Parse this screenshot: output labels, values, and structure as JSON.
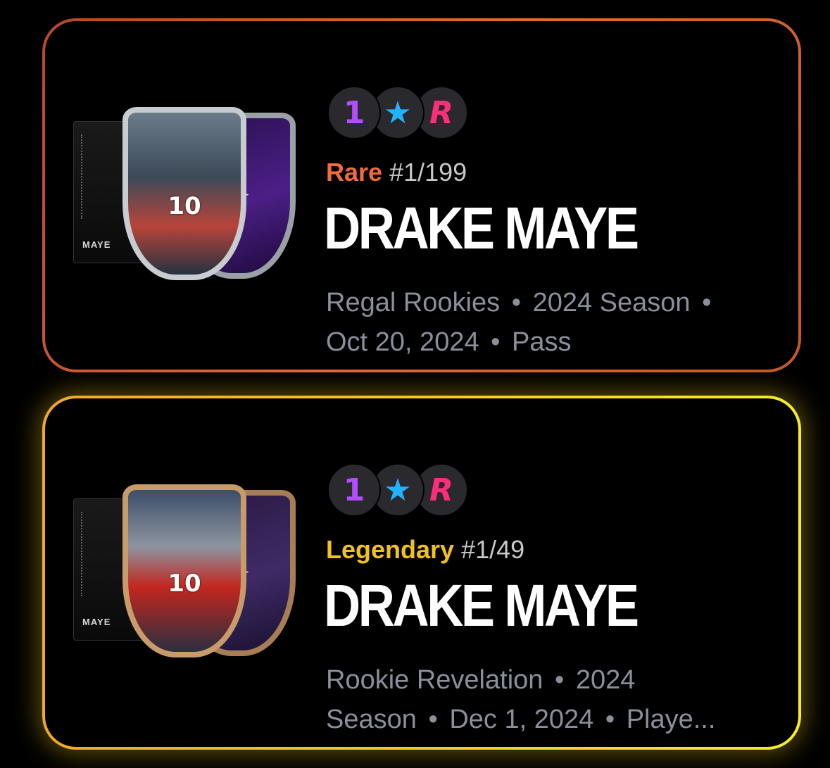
{
  "cards": [
    {
      "tier": "Rare",
      "serial": "#1/199",
      "player": "DRAKE MAYE",
      "box_label": "MAYE",
      "jersey": "10",
      "badges": [
        "1",
        "★",
        "R"
      ],
      "meta_line1": [
        "Regal Rookies",
        "•",
        "2024 Season",
        "•"
      ],
      "meta_line2": [
        "Oct 20, 2024",
        "•",
        "Pass"
      ],
      "accent": "#f26b3d"
    },
    {
      "tier": "Legendary",
      "serial": "#1/49",
      "player": "DRAKE MAYE",
      "box_label": "MAYE",
      "jersey": "10",
      "badges": [
        "1",
        "★",
        "R"
      ],
      "meta_line1": [
        "Rookie Revelation",
        "•",
        "2024"
      ],
      "meta_line2": [
        "Season",
        "•",
        "Dec 1, 2024",
        "•",
        "Playe..."
      ],
      "accent": "#f1c21d"
    }
  ],
  "icons": {
    "badge1": "number-one-badge-icon",
    "badge2": "star-badge-icon",
    "badge3": "rookie-r-badge-icon",
    "team_logo": "patriots-logo-icon"
  }
}
